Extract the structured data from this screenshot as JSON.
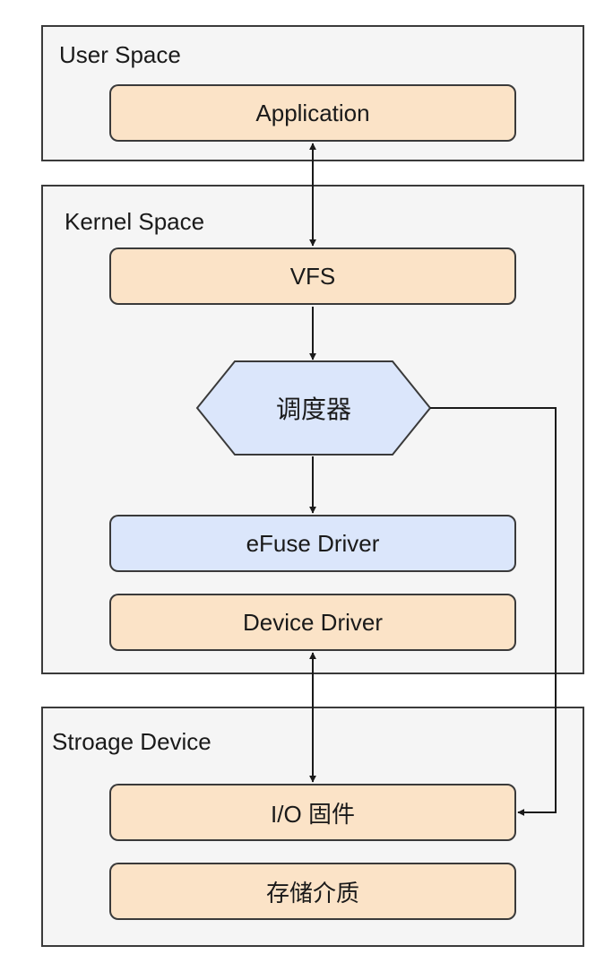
{
  "groups": {
    "user_space": "User Space",
    "kernel_space": "Kernel Space",
    "storage_device": "Stroage Device"
  },
  "nodes": {
    "application": "Application",
    "vfs": "VFS",
    "scheduler": "调度器",
    "efuse_driver": "eFuse Driver",
    "device_driver": "Device Driver",
    "io_firmware": "I/O 固件",
    "storage_medium": "存储介质"
  },
  "colors": {
    "group_fill": "#f5f5f5",
    "orange_node": "#fbe3c7",
    "blue_node": "#dbe6fb",
    "stroke": "#3a3a3a"
  }
}
